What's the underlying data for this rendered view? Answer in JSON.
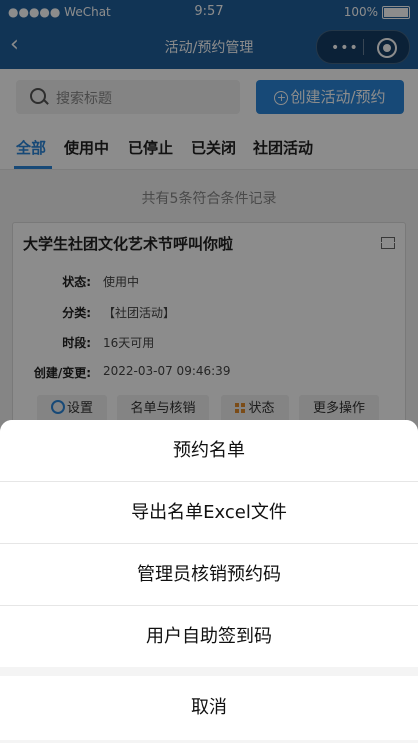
{
  "status_bar": {
    "carrier": "●●●●● WeChat",
    "wifi_icon": "wifi-icon",
    "time": "9:57",
    "battery": "100%"
  },
  "nav": {
    "back_icon": "chevron-left-icon",
    "title": "活动/预约管理",
    "menu_icon": "more-dots-icon",
    "close_icon": "target-circle-icon"
  },
  "search": {
    "placeholder": "搜索标题"
  },
  "create_button": {
    "label": "创建活动/预约"
  },
  "tabs": [
    {
      "label": "全部"
    },
    {
      "label": "使用中"
    },
    {
      "label": "已停止"
    },
    {
      "label": "已关闭"
    },
    {
      "label": "社团活动"
    }
  ],
  "count_text": "共有5条符合条件记录",
  "card": {
    "title": "大学生社团文化艺术节呼叫你啦",
    "fields": [
      {
        "label": "状态:",
        "value": "使用中"
      },
      {
        "label": "分类:",
        "value": "【社团活动】"
      },
      {
        "label": "时段:",
        "value": "16天可用"
      },
      {
        "label": "创建/变更:",
        "value": "2022-03-07 09:46:39"
      }
    ],
    "actions": [
      {
        "label": "设置"
      },
      {
        "label": "名单与核销"
      },
      {
        "label": "状态"
      },
      {
        "label": "更多操作"
      }
    ]
  },
  "action_sheet": {
    "items": [
      {
        "label": "预约名单"
      },
      {
        "label": "导出名单Excel文件"
      },
      {
        "label": "管理员核销预约码"
      },
      {
        "label": "用户自助签到码"
      }
    ],
    "cancel": "取消"
  },
  "colors": {
    "nav_bg": "#1f5f9c",
    "accent": "#2a86d9"
  }
}
